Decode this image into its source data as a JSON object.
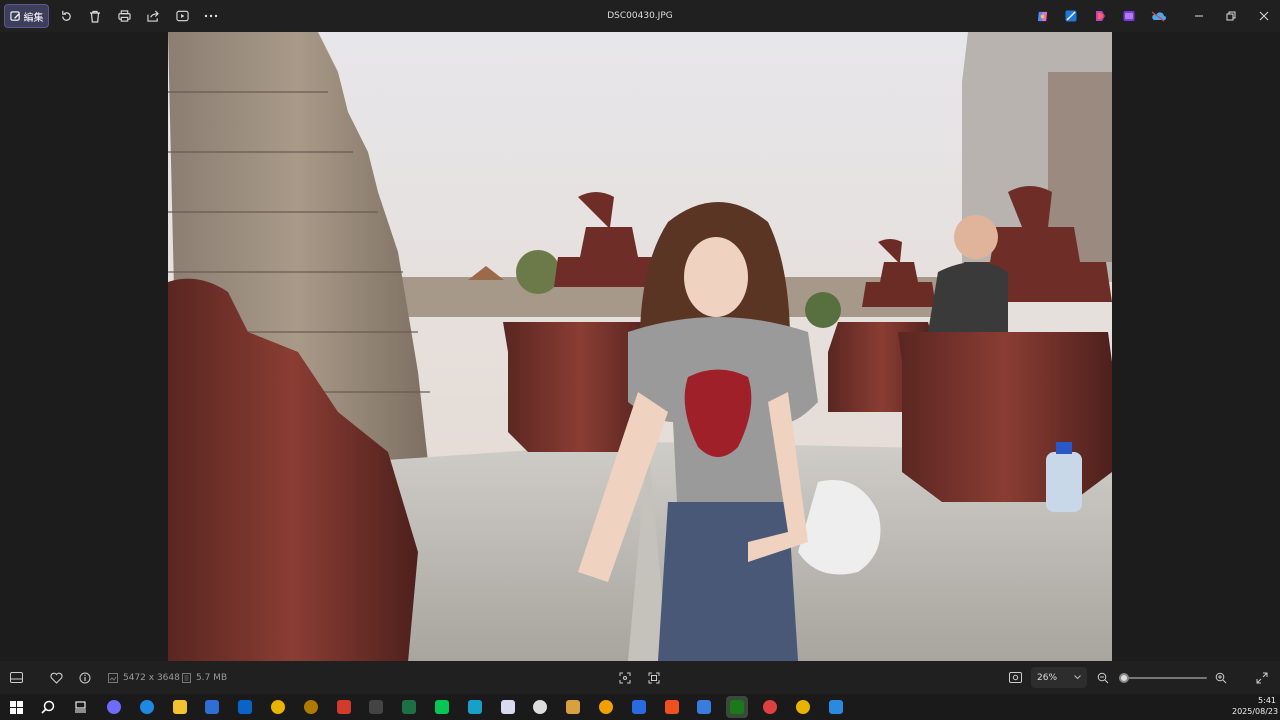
{
  "window": {
    "title": "DSC00430.JPG"
  },
  "toolbar": {
    "edit_label": "編集",
    "icons": [
      "rotate-icon",
      "delete-icon",
      "print-icon",
      "share-icon",
      "slideshow-icon",
      "more-icon"
    ],
    "app_icons": [
      "copilot-icon",
      "photos-editor-icon",
      "clipchamp-icon",
      "designer-icon",
      "onedrive-icon"
    ],
    "window_controls": [
      "minimize-icon",
      "restore-icon",
      "close-icon"
    ]
  },
  "photo": {
    "description_hidden": true
  },
  "bottom": {
    "dimensions": "5472 x 3648",
    "file_size": "5.7 MB",
    "zoom_value": "26%",
    "zoom_fraction": 0.06
  },
  "taskbar": {
    "apps": [
      {
        "name": "copilot",
        "color": "#6c6cff"
      },
      {
        "name": "edge",
        "color": "#1e88e5"
      },
      {
        "name": "file-explorer",
        "color": "#f4c430"
      },
      {
        "name": "store",
        "color": "#2f6fd4"
      },
      {
        "name": "outlook",
        "color": "#0a64c8"
      },
      {
        "name": "chrome",
        "color": "#e8b400"
      },
      {
        "name": "app-dark-circle",
        "color": "#b07a00"
      },
      {
        "name": "app-red",
        "color": "#d23b2b"
      },
      {
        "name": "nc-app",
        "color": "#444444"
      },
      {
        "name": "excel",
        "color": "#1d7044"
      },
      {
        "name": "line",
        "color": "#06c755"
      },
      {
        "name": "app-w",
        "color": "#18a0c8"
      },
      {
        "name": "app-pink",
        "color": "#d9d9f0"
      },
      {
        "name": "chatgpt",
        "color": "#dddddd"
      },
      {
        "name": "app-multicolor",
        "color": "#d9a040"
      },
      {
        "name": "app-orange-circle",
        "color": "#f0a000"
      },
      {
        "name": "app-blue-diamond",
        "color": "#2a6ae0"
      },
      {
        "name": "brave",
        "color": "#f05020"
      },
      {
        "name": "app-chat",
        "color": "#3a7be0"
      },
      {
        "name": "app-green-active",
        "color": "#1a7a1a"
      },
      {
        "name": "chrome-profile",
        "color": "#e04040"
      },
      {
        "name": "chrome-2",
        "color": "#e8b400"
      },
      {
        "name": "photos",
        "color": "#2a8ae0"
      }
    ],
    "clock_time": "5:41",
    "clock_date": "2025/08/23"
  }
}
